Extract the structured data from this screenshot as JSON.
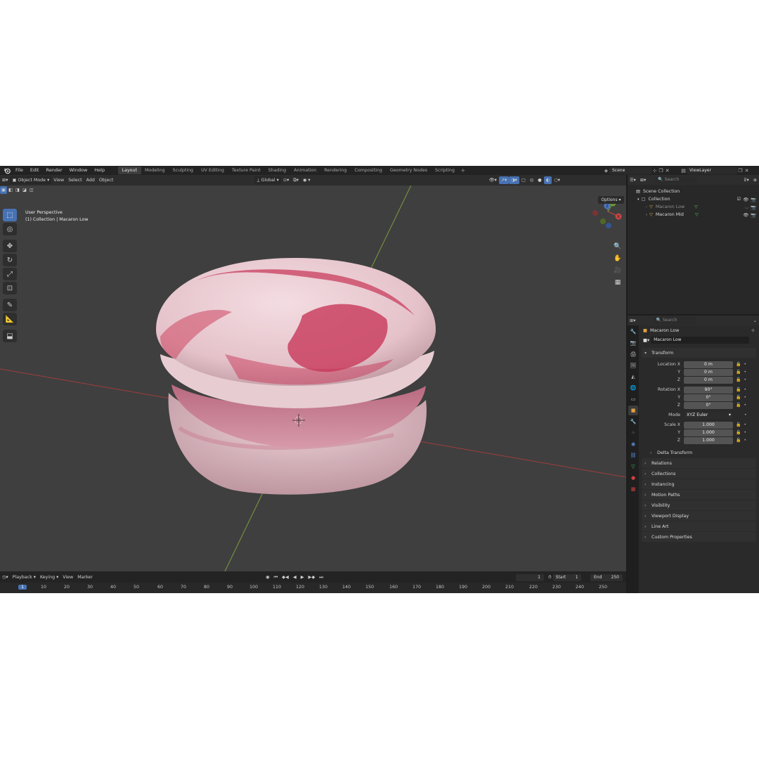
{
  "topbar": {
    "menus": [
      "File",
      "Edit",
      "Render",
      "Window",
      "Help"
    ],
    "workspaces": [
      "Layout",
      "Modeling",
      "Sculpting",
      "UV Editing",
      "Texture Paint",
      "Shading",
      "Animation",
      "Rendering",
      "Compositing",
      "Geometry Nodes",
      "Scripting"
    ],
    "active_workspace": "Layout",
    "add_symbol": "+",
    "scene": "Scene",
    "view_layer": "ViewLayer"
  },
  "viewport": {
    "mode": "Object Mode",
    "menus": [
      "View",
      "Select",
      "Add",
      "Object"
    ],
    "orientation": "Global",
    "options_label": "Options",
    "info_line1": "User Perspective",
    "info_line2": "(1) Collection | Macaron Low",
    "gizmo_axes": {
      "x": "X",
      "y": "Y",
      "z": "Z"
    }
  },
  "timeline": {
    "menus": [
      "Playback",
      "Keying",
      "View",
      "Marker"
    ],
    "current_frame": "1",
    "start_label": "Start",
    "start": "1",
    "end_label": "End",
    "end": "250",
    "ticks": [
      "1",
      "10",
      "20",
      "30",
      "40",
      "50",
      "60",
      "70",
      "80",
      "90",
      "100",
      "110",
      "120",
      "130",
      "140",
      "150",
      "160",
      "170",
      "180",
      "190",
      "200",
      "210",
      "220",
      "230",
      "240",
      "250"
    ]
  },
  "outliner": {
    "search_placeholder": "Search",
    "scene_collection": "Scene Collection",
    "collection": "Collection",
    "items": [
      "Macaron Low",
      "Macaron Mid"
    ]
  },
  "properties": {
    "search_placeholder": "Search",
    "object_name": "Macaron Low",
    "object_field": "Macaron Low",
    "transform_label": "Transform",
    "location": {
      "label_x": "Location X",
      "label_y": "Y",
      "label_z": "Z",
      "x": "0 m",
      "y": "0 m",
      "z": "0 m"
    },
    "rotation": {
      "label_x": "Rotation X",
      "label_y": "Y",
      "label_z": "Z",
      "x": "90°",
      "y": "0°",
      "z": "0°"
    },
    "mode_label": "Mode",
    "mode_value": "XYZ Euler",
    "scale": {
      "label_x": "Scale X",
      "label_y": "Y",
      "label_z": "Z",
      "x": "1.000",
      "y": "1.000",
      "z": "1.000"
    },
    "delta_transform": "Delta Transform",
    "panels": [
      "Relations",
      "Collections",
      "Instancing",
      "Motion Paths",
      "Visibility",
      "Viewport Display",
      "Line Art",
      "Custom Properties"
    ]
  },
  "colors": {
    "accent": "#4772b3",
    "viewport_bg": "#3f3f3f",
    "macaron_base": "#e8c9cf",
    "macaron_marble": "#c83a55",
    "x_axis": "#a83a3a",
    "y_axis": "#7a9a3a"
  }
}
